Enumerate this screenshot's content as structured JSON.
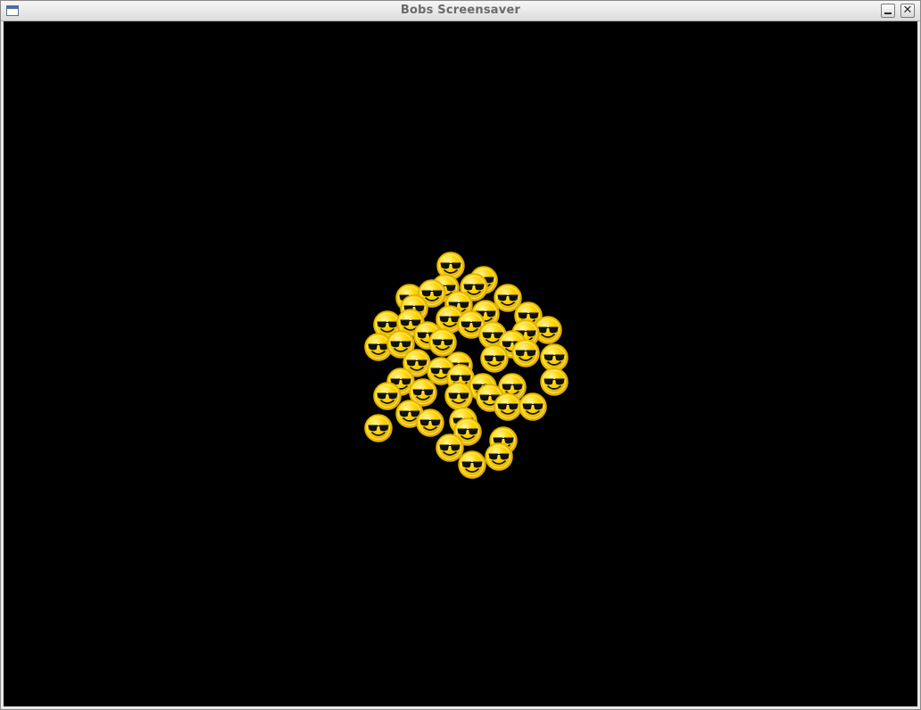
{
  "window": {
    "title": "Bobs Screensaver",
    "icons": {
      "app": "window-icon",
      "minimize": "minimize-icon",
      "close": "close-icon"
    }
  },
  "colors": {
    "background": "#000000",
    "smiley_face": "#ffd400",
    "smiley_rim": "#e0b000",
    "sunglasses": "#111111"
  },
  "screensaver": {
    "sprite": "smiley-with-sunglasses",
    "count": 48
  }
}
